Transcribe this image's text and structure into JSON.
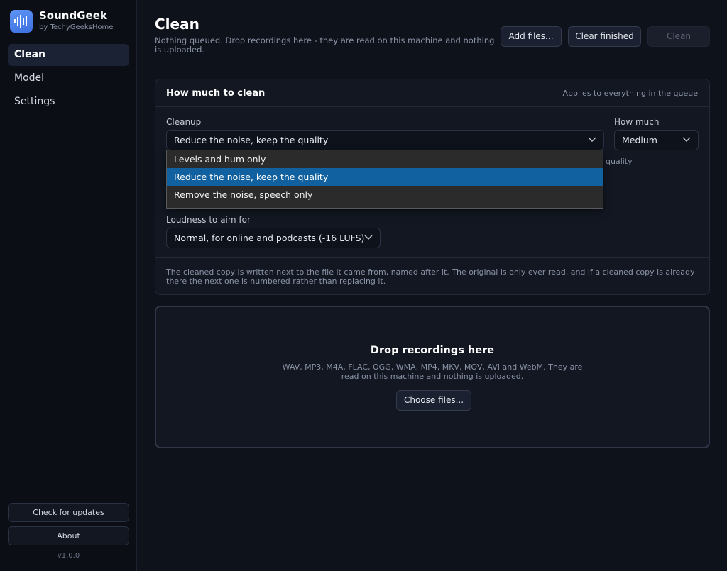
{
  "app": {
    "name": "SoundGeek",
    "byline": "by TechyGeeksHome",
    "version": "v1.0.0"
  },
  "sidebar": {
    "items": [
      {
        "label": "Clean",
        "active": true
      },
      {
        "label": "Model",
        "active": false
      },
      {
        "label": "Settings",
        "active": false
      }
    ],
    "check_updates_label": "Check for updates",
    "about_label": "About"
  },
  "header": {
    "title": "Clean",
    "subtitle": "Nothing queued. Drop recordings here - they are read on this machine and nothing is uploaded.",
    "add_files_label": "Add files...",
    "clear_finished_label": "Clear finished",
    "clean_label": "Clean"
  },
  "settings_card": {
    "title": "How much to clean",
    "note": "Applies to everything in the queue",
    "cleanup_label": "Cleanup",
    "cleanup_value": "Reduce the noise, keep the quality",
    "how_much_label": "How much",
    "how_much_value": "Medium",
    "hidden_hint_fragment": "quality",
    "loudness_label": "Loudness to aim for",
    "loudness_value": "Normal, for online and podcasts (-16 LUFS)",
    "footer_text": "The cleaned copy is written next to the file it came from, named after it. The original is only ever read, and if a cleaned copy is already there the next one is numbered rather than replacing it."
  },
  "cleanup_dropdown": {
    "options": [
      {
        "label": "Levels and hum only",
        "selected": false
      },
      {
        "label": "Reduce the noise, keep the quality",
        "selected": true
      },
      {
        "label": "Remove the noise, speech only",
        "selected": false
      }
    ]
  },
  "dropzone": {
    "title": "Drop recordings here",
    "subtitle": "WAV, MP3, M4A, FLAC, OGG, WMA, MP4, MKV, MOV, AVI and WebM. They are read on this machine and nothing is uploaded.",
    "choose_label": "Choose files..."
  },
  "colors": {
    "background": "#0e121b",
    "sidebar": "#0b0e15",
    "accent": "#4a7ff0",
    "dropdown_selected": "#11609f"
  }
}
